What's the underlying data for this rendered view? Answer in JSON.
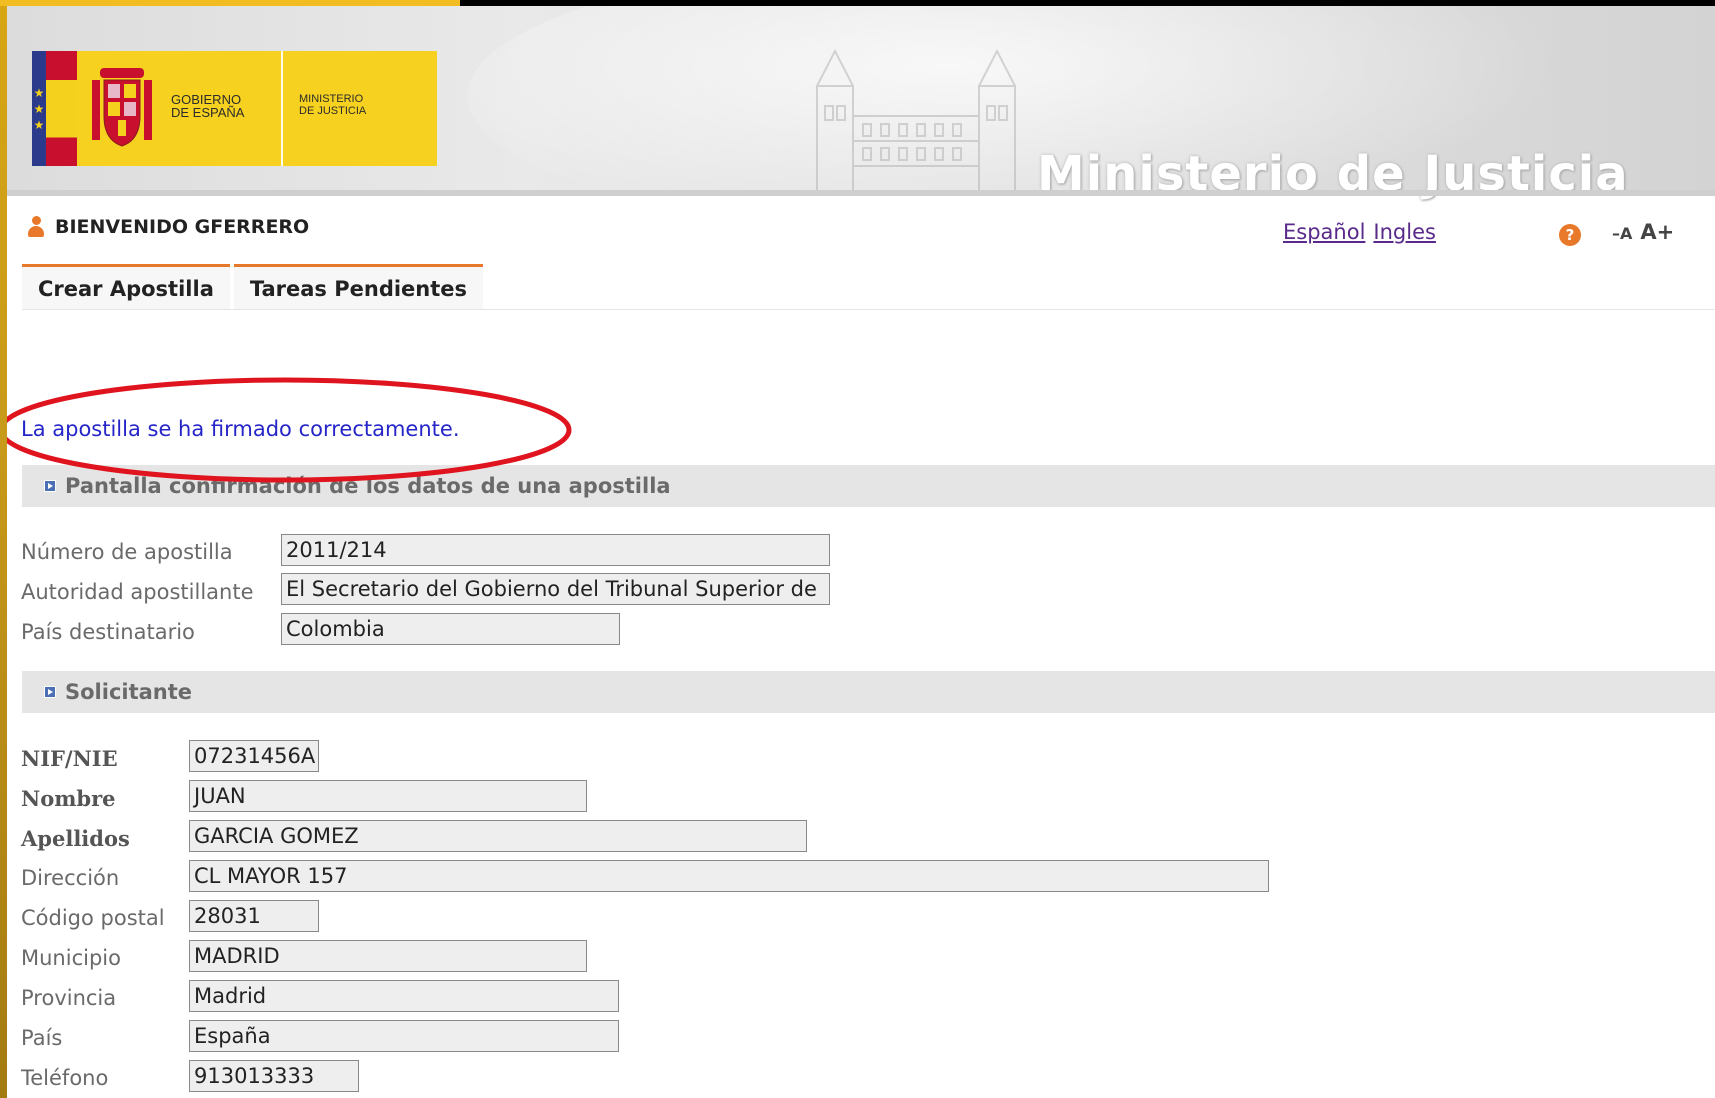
{
  "header": {
    "logo_gov_line1": "GOBIERNO",
    "logo_gov_line2": "DE ESPAÑA",
    "logo_min_line1": "MINISTERIO",
    "logo_min_line2": "DE JUSTICIA",
    "ministry_title": "Ministerio de Justicia"
  },
  "userbar": {
    "welcome": "BIENVENIDO GFERRERO",
    "lang_es": "Español",
    "lang_en": "Ingles",
    "help_glyph": "?",
    "font_decrease": "–A",
    "font_increase": "A+"
  },
  "tabs": [
    {
      "label": "Crear Apostilla"
    },
    {
      "label": "Tareas Pendientes"
    }
  ],
  "message": "La apostilla se ha firmado correctamente.",
  "apostilla": {
    "section_title": "Pantalla confirmación de los datos de una apostilla",
    "fields": [
      {
        "label": "Número de apostilla",
        "value": "2011/214"
      },
      {
        "label": "Autoridad apostillante",
        "value": "El Secretario del Gobierno del Tribunal Superior de"
      },
      {
        "label": "País destinatario",
        "value": "Colombia"
      }
    ]
  },
  "solicitante": {
    "section_title": "Solicitante",
    "fields": [
      {
        "label": "NIF/NIE",
        "value": "07231456A"
      },
      {
        "label": "Nombre",
        "value": "JUAN"
      },
      {
        "label": "Apellidos",
        "value": "GARCIA GOMEZ"
      },
      {
        "label": "Dirección",
        "value": "CL MAYOR 157"
      },
      {
        "label": "Código postal",
        "value": "28031"
      },
      {
        "label": "Municipio",
        "value": "MADRID"
      },
      {
        "label": "Provincia",
        "value": "Madrid"
      },
      {
        "label": "País",
        "value": "España"
      },
      {
        "label": "Teléfono",
        "value": "913013333"
      }
    ]
  },
  "colors": {
    "brand_yellow": "#f6d11f",
    "accent_orange": "#e8782a",
    "message_blue": "#2626c8",
    "annotation_red": "#e0141e"
  },
  "icons": {
    "user": "user-icon",
    "help": "help-icon",
    "section_arrow": "section-arrow-icon"
  }
}
